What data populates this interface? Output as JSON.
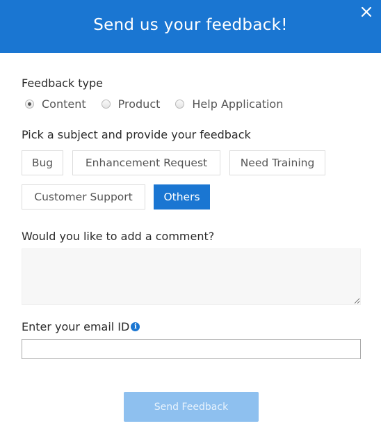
{
  "header": {
    "title": "Send us your feedback!"
  },
  "icons": {
    "close": "close-icon",
    "info": "info-icon"
  },
  "feedback_type": {
    "label": "Feedback type",
    "options": [
      "Content",
      "Product",
      "Help Application"
    ],
    "selected": "Content"
  },
  "subject": {
    "label": "Pick a subject and provide your feedback",
    "chips": [
      "Bug",
      "Enhancement Request",
      "Need Training",
      "Customer Support",
      "Others"
    ],
    "selected": "Others"
  },
  "comment": {
    "label": "Would you like to add a comment?",
    "value": ""
  },
  "email": {
    "label": "Enter your email ID",
    "info_glyph": "i",
    "value": ""
  },
  "submit": {
    "label": "Send Feedback"
  },
  "colors": {
    "primary": "#1a76d2",
    "submit_disabled": "#8ec0ef"
  }
}
